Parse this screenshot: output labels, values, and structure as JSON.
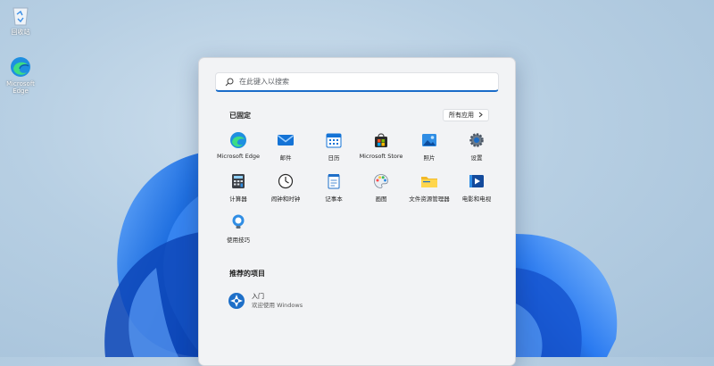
{
  "desktop": {
    "icons": [
      {
        "label": "回收站",
        "icon": "recycle-bin-icon"
      },
      {
        "label": "Microsoft Edge",
        "icon": "edge-icon"
      }
    ]
  },
  "start_menu": {
    "search": {
      "placeholder": "在此键入以搜索"
    },
    "pinned": {
      "title": "已固定",
      "all_apps_label": "所有应用",
      "apps": [
        {
          "label": "Microsoft Edge",
          "icon": "edge-icon"
        },
        {
          "label": "邮件",
          "icon": "mail-icon"
        },
        {
          "label": "日历",
          "icon": "calendar-icon"
        },
        {
          "label": "Microsoft Store",
          "icon": "store-icon"
        },
        {
          "label": "照片",
          "icon": "photos-icon"
        },
        {
          "label": "设置",
          "icon": "settings-gear-icon"
        },
        {
          "label": "计算器",
          "icon": "calculator-icon"
        },
        {
          "label": "闹钟和时钟",
          "icon": "alarm-clock-icon"
        },
        {
          "label": "记事本",
          "icon": "notepad-icon"
        },
        {
          "label": "画图",
          "icon": "paint-icon"
        },
        {
          "label": "文件资源管理器",
          "icon": "file-explorer-icon"
        },
        {
          "label": "电影和电视",
          "icon": "movies-tv-icon"
        },
        {
          "label": "使用技巧",
          "icon": "tips-icon"
        }
      ]
    },
    "recommended": {
      "title": "推荐的项目",
      "items": [
        {
          "title": "入门",
          "subtitle": "欢迎使用 Windows",
          "icon": "get-started-icon"
        }
      ]
    }
  },
  "colors": {
    "accent": "#1a6cc9",
    "menu_bg": "#f2f3f5",
    "bloom_blue": "#1f6fe0"
  }
}
